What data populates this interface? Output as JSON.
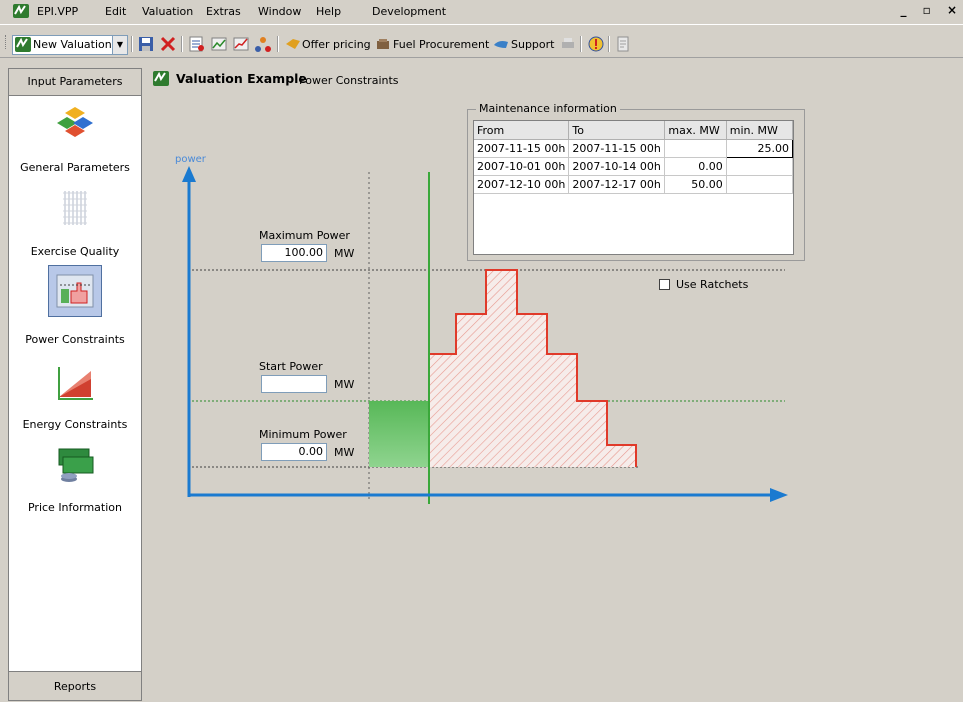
{
  "menu": {
    "app": "EPI.VPP",
    "items": [
      "Edit",
      "Valuation",
      "Extras",
      "Window",
      "Help",
      "Development"
    ],
    "window_controls": "_ ▫ ×"
  },
  "toolbar": {
    "new_valuation": "New Valuation",
    "offer_pricing": "Offer pricing",
    "fuel_procurement": "Fuel Procurement",
    "support": "Support"
  },
  "nav": {
    "header": "Input Parameters",
    "items": [
      {
        "label": "General Parameters",
        "icon": "cubes-icon"
      },
      {
        "label": "Exercise Quality",
        "icon": "grid-icon"
      },
      {
        "label": "Power Constraints",
        "icon": "power-chart-icon"
      },
      {
        "label": "Energy Constraints",
        "icon": "area-chart-icon"
      },
      {
        "label": "Price Information",
        "icon": "money-icon"
      }
    ],
    "footer": "Reports"
  },
  "main": {
    "title": "Valuation Example",
    "subtitle": "Power Constraints"
  },
  "diagram": {
    "axis_label": "power",
    "max_power": {
      "label": "Maximum Power",
      "value": "100.00",
      "unit": "MW"
    },
    "start_power": {
      "label": "Start Power",
      "value": "",
      "unit": "MW"
    },
    "min_power": {
      "label": "Minimum Power",
      "value": "0.00",
      "unit": "MW"
    }
  },
  "maintenance": {
    "legend": "Maintenance information",
    "columns": [
      "From",
      "To",
      "max. MW",
      "min. MW"
    ],
    "rows": [
      [
        "2007-11-15 00h",
        "2007-11-15 00h",
        "",
        "25.00"
      ],
      [
        "2007-10-01 00h",
        "2007-10-14 00h",
        "0.00",
        ""
      ],
      [
        "2007-12-10 00h",
        "2007-12-17 00h",
        "50.00",
        ""
      ]
    ]
  },
  "ratchets": {
    "label": "Use Ratchets",
    "checked": false
  },
  "colors": {
    "axis": "#1a7ad0",
    "green": "#3aa83a",
    "red": "#e03a2a"
  }
}
